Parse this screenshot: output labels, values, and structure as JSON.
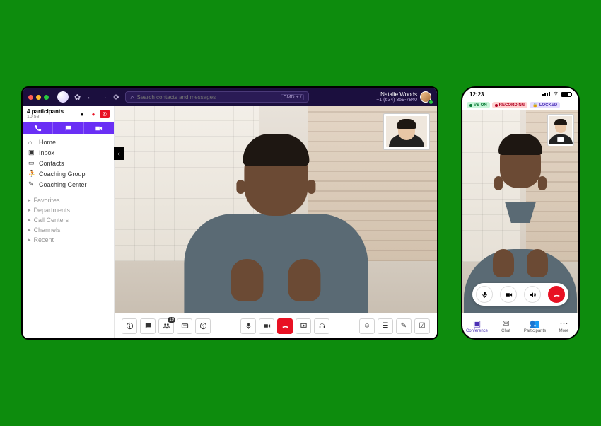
{
  "desktop": {
    "search": {
      "placeholder": "Search contacts and messages",
      "kbd": "CMD + /"
    },
    "user": {
      "name": "Natalie Woods",
      "phone": "+1 (634) 359-7840"
    },
    "sidebar": {
      "participants_label": "4 participants",
      "time": "10:58",
      "nav": [
        {
          "icon": "home",
          "label": "Home"
        },
        {
          "icon": "inbox",
          "label": "Inbox"
        },
        {
          "icon": "contacts",
          "label": "Contacts"
        },
        {
          "icon": "group",
          "label": "Coaching Group"
        },
        {
          "icon": "edit",
          "label": "Coaching Center"
        }
      ],
      "sections": [
        "Favorites",
        "Departments",
        "Call Centers",
        "Channels",
        "Recent"
      ]
    },
    "toolbar": {
      "left": [
        "info-icon",
        "chat-icon",
        "participants-icon",
        "apps-icon",
        "help-icon"
      ],
      "center": [
        "mic-icon",
        "video-icon",
        "hangup-icon",
        "share-icon",
        "headset-icon"
      ],
      "right": [
        "emoji-icon",
        "list-icon",
        "edit-icon",
        "check-icon"
      ],
      "participants_badge": "19"
    }
  },
  "mobile": {
    "clock": "12:23",
    "pills": {
      "on": "VS ON",
      "rec": "RECORDING",
      "lock": "LOCKED"
    },
    "tabs": [
      {
        "icon": "conference",
        "label": "Conference",
        "active": true
      },
      {
        "icon": "chat",
        "label": "Chat",
        "active": false
      },
      {
        "icon": "participants",
        "label": "Participants",
        "active": false
      },
      {
        "icon": "more",
        "label": "More",
        "active": false
      }
    ]
  }
}
